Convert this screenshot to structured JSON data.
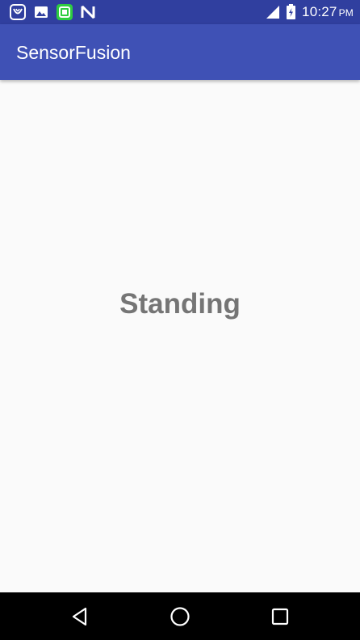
{
  "status_bar": {
    "notification_icons": [
      "saavn-icon",
      "gallery-icon",
      "app-icon",
      "n-icon"
    ],
    "time": "10:27",
    "ampm": "PM",
    "color": "#303f9f"
  },
  "app_bar": {
    "title": "SensorFusion",
    "color": "#3f51b5"
  },
  "main": {
    "activity_label": "Standing",
    "label_color": "#757575"
  },
  "nav_bar": {
    "buttons": [
      "back-icon",
      "home-icon",
      "recents-icon"
    ]
  }
}
